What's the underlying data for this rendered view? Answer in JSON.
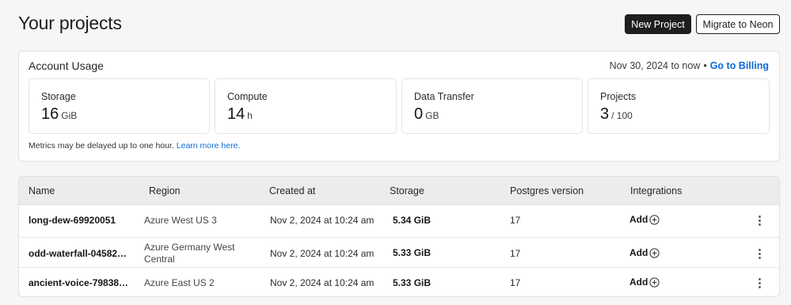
{
  "header": {
    "title": "Your projects",
    "new_project_label": "New Project",
    "migrate_label": "Migrate to Neon"
  },
  "usage": {
    "title": "Account Usage",
    "range_text": "Nov 30, 2024 to now",
    "bullet": "•",
    "billing_link": "Go to Billing",
    "metrics": [
      {
        "label": "Storage",
        "value": "16",
        "unit": "GiB"
      },
      {
        "label": "Compute",
        "value": "14",
        "unit": "h"
      },
      {
        "label": "Data Transfer",
        "value": "0",
        "unit": "GB"
      },
      {
        "label": "Projects",
        "value": "3",
        "unit": "/ 100"
      }
    ],
    "note_text": "Metrics may be delayed up to one hour.",
    "note_link": "Learn more here."
  },
  "table": {
    "columns": [
      "Name",
      "Region",
      "Created at",
      "Storage",
      "Postgres version",
      "Integrations"
    ],
    "rows": [
      {
        "name": "long-dew-69920051",
        "region": "Azure West US 3",
        "created": "Nov 2, 2024 at 10:24 am",
        "storage": "5.34 GiB",
        "postgres": "17",
        "integrations": "Add"
      },
      {
        "name": "odd-waterfall-04582…",
        "region": "Azure Germany West Central",
        "created": "Nov 2, 2024 at 10:24 am",
        "storage": "5.33 GiB",
        "postgres": "17",
        "integrations": "Add"
      },
      {
        "name": "ancient-voice-79838…",
        "region": "Azure East US 2",
        "created": "Nov 2, 2024 at 10:24 am",
        "storage": "5.33 GiB",
        "postgres": "17",
        "integrations": "Add"
      }
    ],
    "more_icon": "⋮"
  },
  "colors": {
    "accent_link": "#0b6bd6",
    "primary_button": "#1e1e1e",
    "page_background": "#f6f6f7"
  }
}
